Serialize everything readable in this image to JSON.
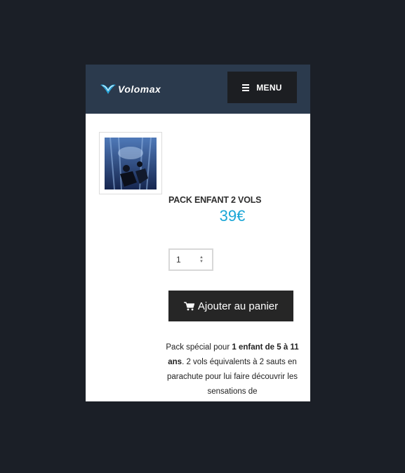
{
  "header": {
    "logo_text": "Volomax",
    "menu_label": "MENU",
    "colors": {
      "bar": "#2b3a4d",
      "menu_button": "#1c1e22",
      "logo_accent": "#29a8dc"
    }
  },
  "product": {
    "image_icon": "indoor-skydiving-photo",
    "title": "PACK ENFANT 2 VOLS",
    "price": "39€",
    "price_color": "#1aa6d6",
    "quantity": "1",
    "add_to_cart_label": "Ajouter au panier",
    "cart_icon": "shopping-cart-icon",
    "description": {
      "part1": "Pack spécial pour ",
      "bold": "1 enfant de 5 à 11 ans",
      "part2": ". 2 vols équivalents à 2 sauts en parachute pour lui faire découvrir les sensations de"
    }
  }
}
